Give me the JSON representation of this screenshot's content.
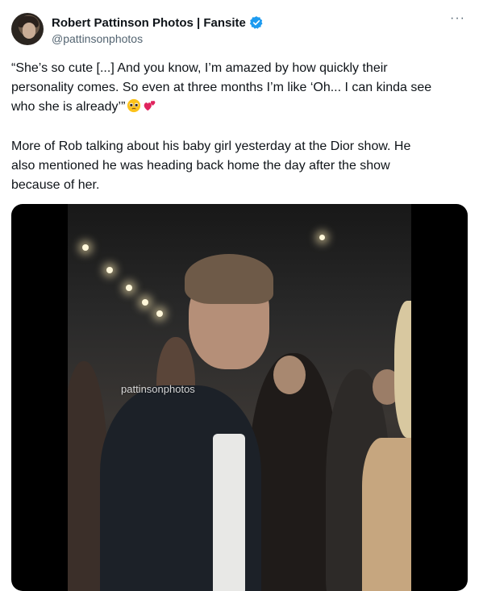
{
  "tweet": {
    "display_name": "Robert Pattinson Photos | Fansite",
    "handle": "@pattinsonphotos",
    "more_label": "···",
    "paragraph1_lines": [
      "“She’s so cute [...] And you know, I’m amazed by how quickly their",
      "personality comes. So even at three months I’m like ‘Oh... I can kinda see",
      "who she is already’”"
    ],
    "paragraph2_lines": [
      "More of Rob talking about his baby girl yesterday at the Dior show. He",
      "also mentioned he was heading back home the day after the show",
      "because of her."
    ],
    "emojis": [
      "pleading-face-icon",
      "two-hearts-icon"
    ]
  },
  "media": {
    "watermark": "pattinsonphotos"
  },
  "colors": {
    "text": "#0f1419",
    "secondary": "#536471",
    "verified": "#1d9bf0",
    "media_bg": "#000000"
  }
}
